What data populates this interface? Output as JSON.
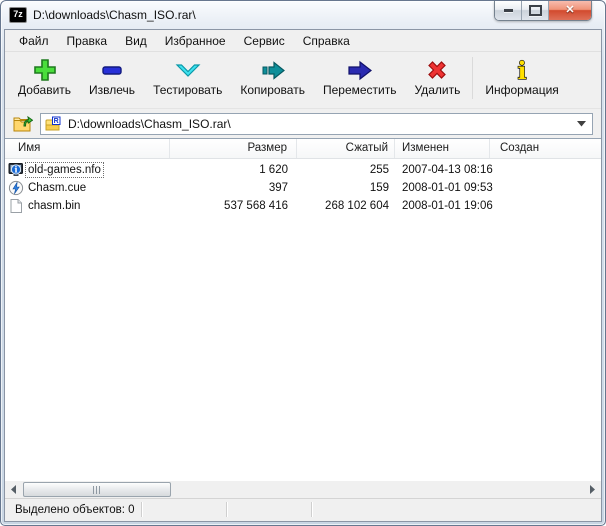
{
  "window": {
    "title": "D:\\downloads\\Chasm_ISO.rar\\",
    "app_icon_text": "7z"
  },
  "menu": {
    "items": [
      "Файл",
      "Правка",
      "Вид",
      "Избранное",
      "Сервис",
      "Справка"
    ]
  },
  "toolbar": {
    "buttons": [
      {
        "label": "Добавить",
        "icon": "add-plus-icon"
      },
      {
        "label": "Извлечь",
        "icon": "extract-minus-icon"
      },
      {
        "label": "Тестировать",
        "icon": "test-chevron-icon"
      },
      {
        "label": "Копировать",
        "icon": "copy-arrow-icon"
      },
      {
        "label": "Переместить",
        "icon": "move-arrow-icon"
      },
      {
        "label": "Удалить",
        "icon": "delete-x-icon"
      },
      {
        "label": "Информация",
        "icon": "info-i-icon"
      }
    ]
  },
  "address": {
    "path": "D:\\downloads\\Chasm_ISO.rar\\",
    "up_icon": "folder-up-icon",
    "archive_icon": "rar-archive-icon"
  },
  "list": {
    "columns": [
      "Имя",
      "Размер",
      "Сжатый",
      "Изменен",
      "Создан"
    ],
    "rows": [
      {
        "icon": "nfo-file-icon",
        "name": "old-games.nfo",
        "size": "1 620",
        "packed": "255",
        "modified": "2007-04-13 08:16",
        "created": ""
      },
      {
        "icon": "cue-file-icon",
        "name": "Chasm.cue",
        "size": "397",
        "packed": "159",
        "modified": "2008-01-01 09:53",
        "created": ""
      },
      {
        "icon": "bin-file-icon",
        "name": "chasm.bin",
        "size": "537 568 416",
        "packed": "268 102 604",
        "modified": "2008-01-01 19:06",
        "created": ""
      }
    ]
  },
  "statusbar": {
    "selected": "Выделено объектов: 0"
  },
  "colors": {
    "close_button": "#d24a2e",
    "add_green": "#4ade3c",
    "extract_blue": "#2730d8",
    "test_cyan": "#3fe2ef",
    "copy_teal": "#0e8f9a",
    "move_navy": "#2a2ab0",
    "delete_red": "#ee3333",
    "info_yellow": "#ffe000"
  }
}
